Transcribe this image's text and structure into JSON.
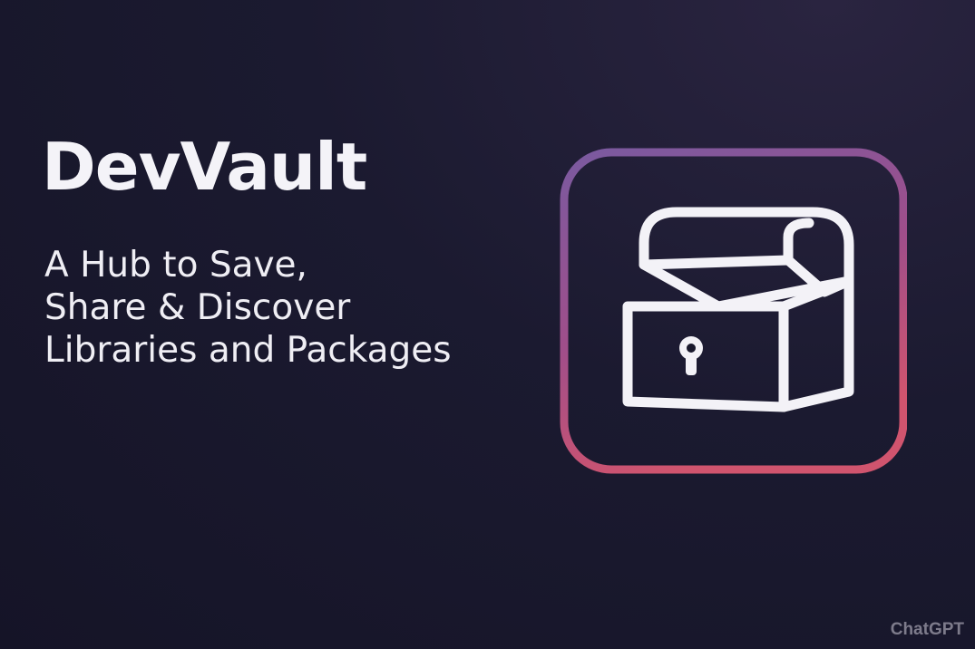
{
  "hero": {
    "title": "DevVault",
    "tagline_lines": [
      "A Hub to Save,",
      "Share & Discover",
      "Libraries and Packages"
    ]
  },
  "logo": {
    "icon": "treasure-chest-icon",
    "frame_gradient": [
      "#7a5aa0",
      "#a04e8a",
      "#d0546e"
    ],
    "stroke_color": "#f3f2f7"
  },
  "watermark": {
    "text": "ChatGPT"
  }
}
